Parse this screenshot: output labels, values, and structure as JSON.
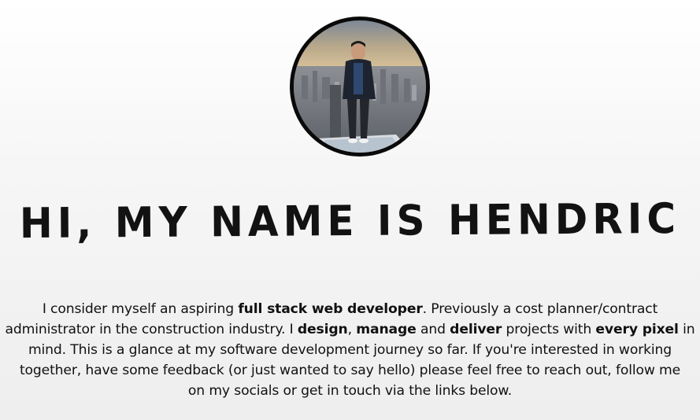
{
  "profile": {
    "avatar_alt": "Profile photo of Hendric standing on an observation deck over a city skyline",
    "heading": "HI, MY NAME IS HENDRIC"
  },
  "bio": {
    "l1_a": "I consider myself an aspiring ",
    "l1_b": "full stack web developer",
    "l1_c": ". Previously a cost planner/contract",
    "l2_a": "administrator in the construction industry. I ",
    "l2_b": "design",
    "l2_c": ", ",
    "l2_d": "manage",
    "l2_e": " and ",
    "l2_f": "deliver",
    "l2_g": " projects with ",
    "l2_h": "every pixel",
    "l2_i": " in",
    "l3": "mind. This is a glance at my software development journey so far. If you're interested in working",
    "l4": "together, have some feedback (or just wanted to say hello) please feel free to reach out, follow me",
    "l5": "on my socials or get in touch via the links below."
  },
  "colors": {
    "text": "#111111",
    "avatar_border": "#0a0a0a",
    "background_top": "#ffffff",
    "background_bottom": "#eeeeee"
  }
}
